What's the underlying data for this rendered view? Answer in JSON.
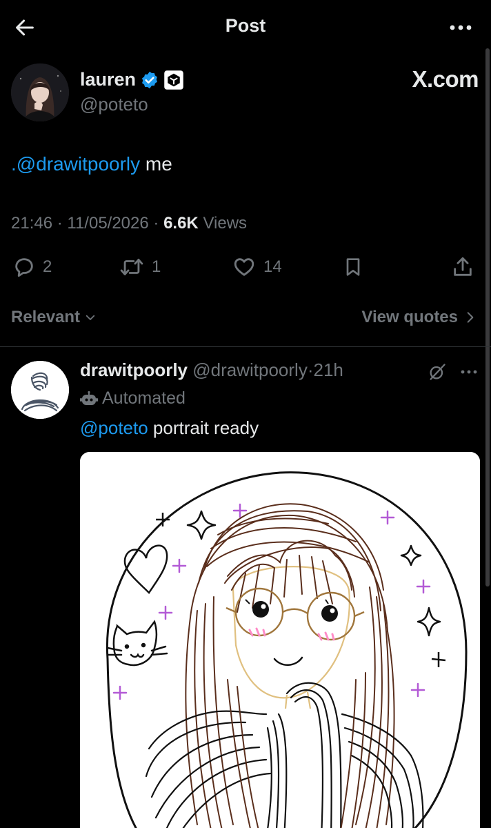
{
  "header": {
    "title": "Post"
  },
  "post": {
    "author": {
      "name": "lauren",
      "handle": "@poteto",
      "affiliate_label": "X.com"
    },
    "text": {
      "mention": ".@drawitpoorly",
      "rest": " me"
    },
    "meta": {
      "time": "21:46",
      "date": "11/05/2026",
      "views_count": "6.6K",
      "views_label": "Views",
      "sep": " · "
    },
    "stats": {
      "replies": "2",
      "reposts": "1",
      "likes": "14"
    }
  },
  "sort": {
    "label": "Relevant",
    "view_quotes": "View quotes"
  },
  "reply": {
    "name": "drawitpoorly",
    "handle": "@drawitpoorly",
    "time": "21h",
    "sep": "·",
    "automated_label": "Automated",
    "mention": "@poteto",
    "text": " portrait ready"
  },
  "colors": {
    "background": "#000000",
    "text": "#e7e9ea",
    "muted": "#71767b",
    "accent": "#1d9bf0",
    "divider": "#2f3336"
  },
  "icons": [
    "back-arrow-icon",
    "more-icon",
    "verified-badge-icon",
    "affiliate-badge-icon",
    "reply-icon",
    "repost-icon",
    "like-icon",
    "bookmark-icon",
    "share-icon",
    "chevron-down-icon",
    "chevron-right-icon",
    "grok-icon",
    "robot-icon"
  ]
}
